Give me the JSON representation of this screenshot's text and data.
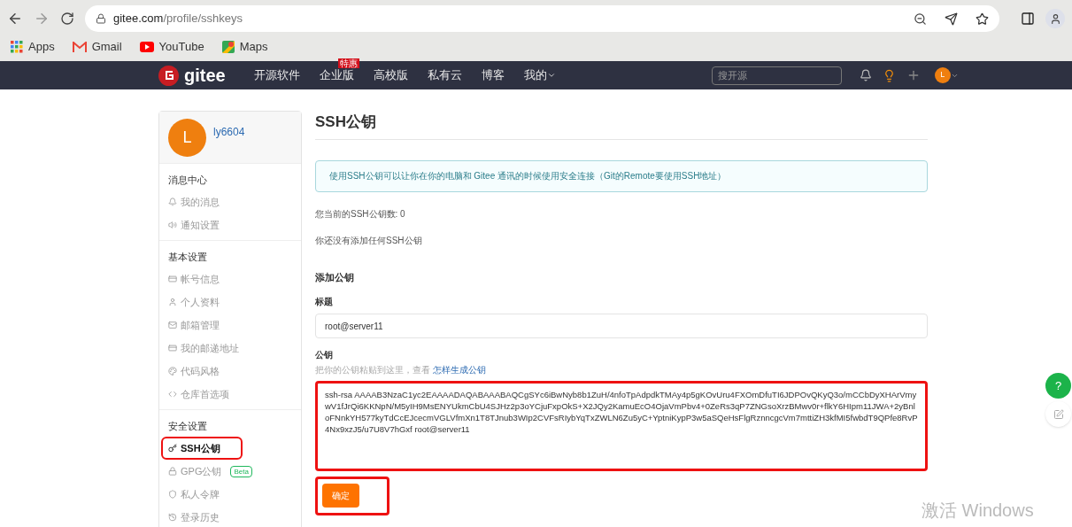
{
  "browser": {
    "url_host": "gitee.com",
    "url_path": "/profile/sshkeys",
    "bookmarks": [
      {
        "label": "Apps",
        "kind": "apps"
      },
      {
        "label": "Gmail",
        "kind": "gmail"
      },
      {
        "label": "YouTube",
        "kind": "youtube"
      },
      {
        "label": "Maps",
        "kind": "maps"
      }
    ]
  },
  "navbar": {
    "brand": "gitee",
    "links": [
      {
        "label": "开源软件"
      },
      {
        "label": "企业版",
        "badge": "特惠"
      },
      {
        "label": "高校版"
      },
      {
        "label": "私有云"
      },
      {
        "label": "博客"
      },
      {
        "label": "我的",
        "dropdown": true
      }
    ],
    "search": {
      "placeholder": "搜开源"
    },
    "avatar": "L"
  },
  "sidebar": {
    "user": {
      "avatar": "L",
      "name": "ly6604"
    },
    "groups": [
      {
        "title": "消息中心",
        "items": [
          {
            "label": "我的消息",
            "kind": "bell",
            "selected": false
          },
          {
            "label": "通知设置",
            "kind": "speaker",
            "selected": false
          }
        ]
      },
      {
        "title": "基本设置",
        "items": [
          {
            "label": "帐号信息",
            "kind": "card",
            "selected": false
          },
          {
            "label": "个人资料",
            "kind": "user",
            "selected": false
          },
          {
            "label": "邮箱管理",
            "kind": "mail",
            "selected": false
          },
          {
            "label": "我的邮递地址",
            "kind": "card",
            "selected": false
          },
          {
            "label": "代码风格",
            "kind": "palette",
            "selected": false
          },
          {
            "label": "仓库首选项",
            "kind": "code",
            "selected": false
          }
        ]
      },
      {
        "title": "安全设置",
        "items": [
          {
            "label": "SSH公钥",
            "kind": "key",
            "selected": true
          },
          {
            "label": "GPG公钥",
            "kind": "lock",
            "selected": false,
            "badge": "Beta"
          },
          {
            "label": "私人令牌",
            "kind": "shield",
            "selected": false
          },
          {
            "label": "登录历史",
            "kind": "history",
            "selected": false
          }
        ]
      }
    ]
  },
  "main": {
    "title": "SSH公钥",
    "notice": "使用SSH公钥可以让你在你的电脑和 Gitee 通讯的时候使用安全连接（Git的Remote要使用SSH地址）",
    "count_text": "您当前的SSH公钥数: 0",
    "empty_text": "你还没有添加任何SSH公钥",
    "form_title": "添加公钥",
    "title_label": "标题",
    "title_value": "root@server11",
    "key_label": "公钥",
    "key_hint": "把你的公钥粘贴到这里，查看",
    "key_hint_link": "怎样生成公钥",
    "key_value": "ssh-rsa AAAAB3NzaC1yc2EAAAADAQABAAABAQCgSYc6iBwNyb8b1ZuH/4nfoTpAdpdkTMAy4p5gKOvUru4FXOmDfuTI6JDPOvQKyQ3o/mCCbDyXHArVmywV1fJrQi6KKNpN/M5yIH9MsENYUkmCbU4SJHz2p3oYCjuFxpOkS+X2JQy2KamuEcO4OjaVmPbv4+0ZeRs3qP7ZNGsoXrzBMwv0r+flkY6HIpm11JWA+2yBnloFNnkYH577kyTdCcEJcecmVGLVfmXn1T8TJnub3WIp2CVFsRIybYqTxZWLN6Zu5yC+YptniKypP3w5aSQeHsFlgRznncgcVm7mttiZH3kfMI5fwbdT9QPfe8RvP4Nx9xzJ5/u7U8V7hGxf root@server11",
    "submit": "确定"
  },
  "floating": {
    "help": "?"
  },
  "os_overlay": {
    "text": "激活 Windows"
  }
}
